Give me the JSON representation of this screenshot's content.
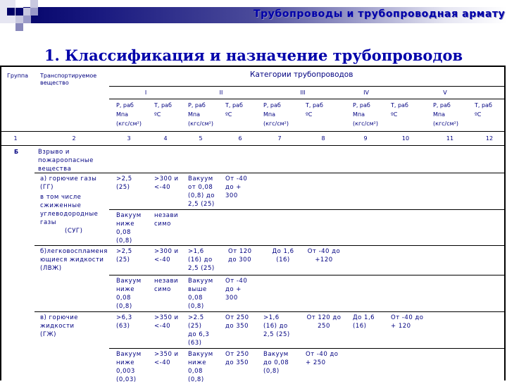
{
  "banner": {
    "title": "Трубопроводы и трубопроводная армату"
  },
  "heading": "1.   Классификация и назначение трубопроводов",
  "table": {
    "header": {
      "group": "Группа",
      "substance": [
        "Транспортируемое",
        "вещество"
      ],
      "categories_title": "Категории трубопроводов",
      "categories": [
        "I",
        "II",
        "III",
        "IV",
        "V"
      ],
      "p_label": [
        "Р, раб",
        "Мпа",
        "(кгс/см²)"
      ],
      "t_label": [
        "Т, раб",
        "ºС"
      ],
      "column_numbers": [
        "1",
        "2",
        "3",
        "4",
        "5",
        "6",
        "7",
        "8",
        "9",
        "10",
        "11",
        "12"
      ]
    },
    "group_b": {
      "group": "Б",
      "substance": [
        "Взрыво и",
        "пожароопасные",
        "вещества"
      ]
    },
    "rows": [
      {
        "substance": [
          "а) горючие газы",
          "(ГГ)",
          "в том числе",
          "сжиженные",
          "углеводородные",
          "газы",
          "(СУГ)"
        ],
        "lines": [
          {
            "c3": [
              ">2,5",
              "(25)"
            ],
            "c4": [
              ">300 и",
              "<-40"
            ],
            "c5": [
              "Вакуум",
              "от 0,08",
              "(0,8) до",
              "2,5 (25)"
            ],
            "c6": [
              "От -40",
              "до +",
              "300"
            ]
          },
          {
            "c3": [
              "Вакуум",
              "ниже",
              "0,08",
              "(0,8)"
            ],
            "c4": [
              "незави",
              "симо"
            ]
          }
        ]
      },
      {
        "substance": [
          "б)легковоспламеня",
          "ющиеся жидкости",
          "(ЛВЖ)"
        ],
        "lines": [
          {
            "c3": [
              ">2,5",
              "(25)"
            ],
            "c4": [
              ">300 и",
              "<-40"
            ],
            "c5": [
              ">1,6",
              "(16) до",
              "2,5 (25)"
            ],
            "c6": [
              "От 120",
              "до 300"
            ],
            "c7": [
              "До 1,6",
              "(16)"
            ],
            "c8": [
              "От -40 до",
              "+120"
            ]
          },
          {
            "c3": [
              "Вакуум",
              "ниже",
              "0,08",
              "(0,8)"
            ],
            "c4": [
              "незави",
              "симо"
            ],
            "c5": [
              "Вакуум",
              "выше",
              "0,08",
              "(0,8)"
            ],
            "c6": [
              "От -40",
              "до +",
              "300"
            ]
          }
        ]
      },
      {
        "substance": [
          "в) горючие",
          "жидкости",
          "(ГЖ)"
        ],
        "lines": [
          {
            "c3": [
              ">6,3",
              "(63)"
            ],
            "c4": [
              ">350 и",
              "<-40"
            ],
            "c5": [
              ">2.5",
              "(25)",
              "до 6,3",
              "(63)"
            ],
            "c6": [
              "От 250",
              "до 350"
            ],
            "c7": [
              ">1,6",
              "(16) до",
              "2,5 (25)"
            ],
            "c8": [
              "От 120 до",
              "250"
            ],
            "c9": [
              "До 1,6",
              "(16)"
            ],
            "c10": [
              "От -40 до",
              "+ 120"
            ]
          },
          {
            "c3": [
              "Вакуум",
              "ниже",
              "0,003",
              "(0,03)"
            ],
            "c4": [
              ">350 и",
              "<-40"
            ],
            "c5": [
              "Вакуум",
              "ниже",
              "0,08",
              "(0,8)"
            ],
            "c6": [
              "От 250",
              "до 350"
            ],
            "c7": [
              "Вакуум",
              "до 0,08",
              "(0,8)"
            ],
            "c8": [
              "От -40 до",
              "+ 250"
            ]
          }
        ]
      }
    ]
  }
}
